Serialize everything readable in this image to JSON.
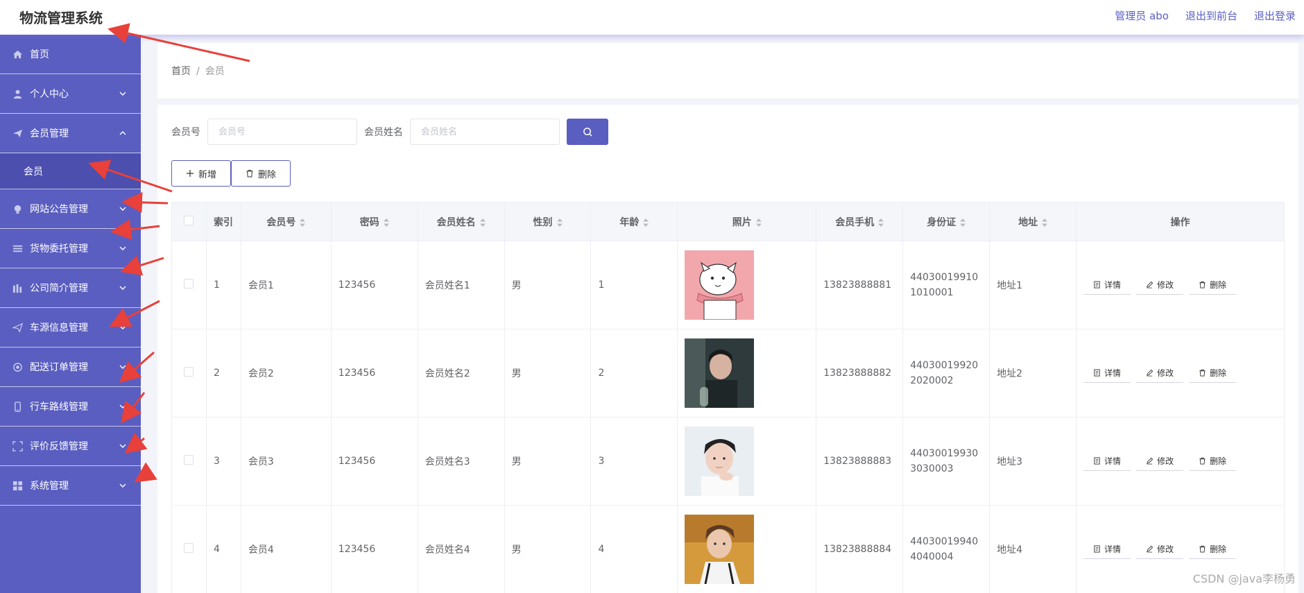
{
  "header": {
    "title": "物流管理系统",
    "admin_label": "管理员 abo",
    "back_frontend": "退出到前台",
    "logout": "退出登录"
  },
  "sidebar": {
    "items": [
      {
        "label": "首页",
        "icon": "home-icon"
      },
      {
        "label": "个人中心",
        "icon": "user-icon"
      },
      {
        "label": "会员管理",
        "icon": "send-icon",
        "expanded": true
      },
      {
        "label": "网站公告管理",
        "icon": "bulb-icon"
      },
      {
        "label": "货物委托管理",
        "icon": "list-icon"
      },
      {
        "label": "公司简介管理",
        "icon": "bar-icon"
      },
      {
        "label": "车源信息管理",
        "icon": "paper-plane-icon"
      },
      {
        "label": "配送订单管理",
        "icon": "circle-icon"
      },
      {
        "label": "行车路线管理",
        "icon": "mobile-icon"
      },
      {
        "label": "评价反馈管理",
        "icon": "frame-icon"
      },
      {
        "label": "系统管理",
        "icon": "grid-icon"
      }
    ],
    "submenu_member": "会员"
  },
  "breadcrumb": {
    "home": "首页",
    "separator": "/",
    "current": "会员"
  },
  "search": {
    "member_no_label": "会员号",
    "member_no_placeholder": "会员号",
    "member_name_label": "会员姓名",
    "member_name_placeholder": "会员姓名"
  },
  "actions": {
    "add": "新增",
    "delete": "删除"
  },
  "table": {
    "columns": [
      "索引",
      "会员号",
      "密码",
      "会员姓名",
      "性别",
      "年龄",
      "照片",
      "会员手机",
      "身份证",
      "地址",
      "操作"
    ],
    "rows": [
      {
        "index": "1",
        "member_no": "会员1",
        "password": "123456",
        "name": "会员姓名1",
        "gender": "男",
        "age": "1",
        "phone": "13823888881",
        "id_card": "440300199101010001",
        "address": "地址1"
      },
      {
        "index": "2",
        "member_no": "会员2",
        "password": "123456",
        "name": "会员姓名2",
        "gender": "男",
        "age": "2",
        "phone": "13823888882",
        "id_card": "440300199202020002",
        "address": "地址2"
      },
      {
        "index": "3",
        "member_no": "会员3",
        "password": "123456",
        "name": "会员姓名3",
        "gender": "男",
        "age": "3",
        "phone": "13823888883",
        "id_card": "440300199303030003",
        "address": "地址3"
      },
      {
        "index": "4",
        "member_no": "会员4",
        "password": "123456",
        "name": "会员姓名4",
        "gender": "男",
        "age": "4",
        "phone": "13823888884",
        "id_card": "440300199404040004",
        "address": "地址4"
      }
    ],
    "row_actions": {
      "detail": "详情",
      "edit": "修改",
      "delete": "删除"
    }
  },
  "watermark": "CSDN @java李杨勇",
  "colors": {
    "primary": "#5a5ec0",
    "annotation_arrow": "#e8403a"
  }
}
